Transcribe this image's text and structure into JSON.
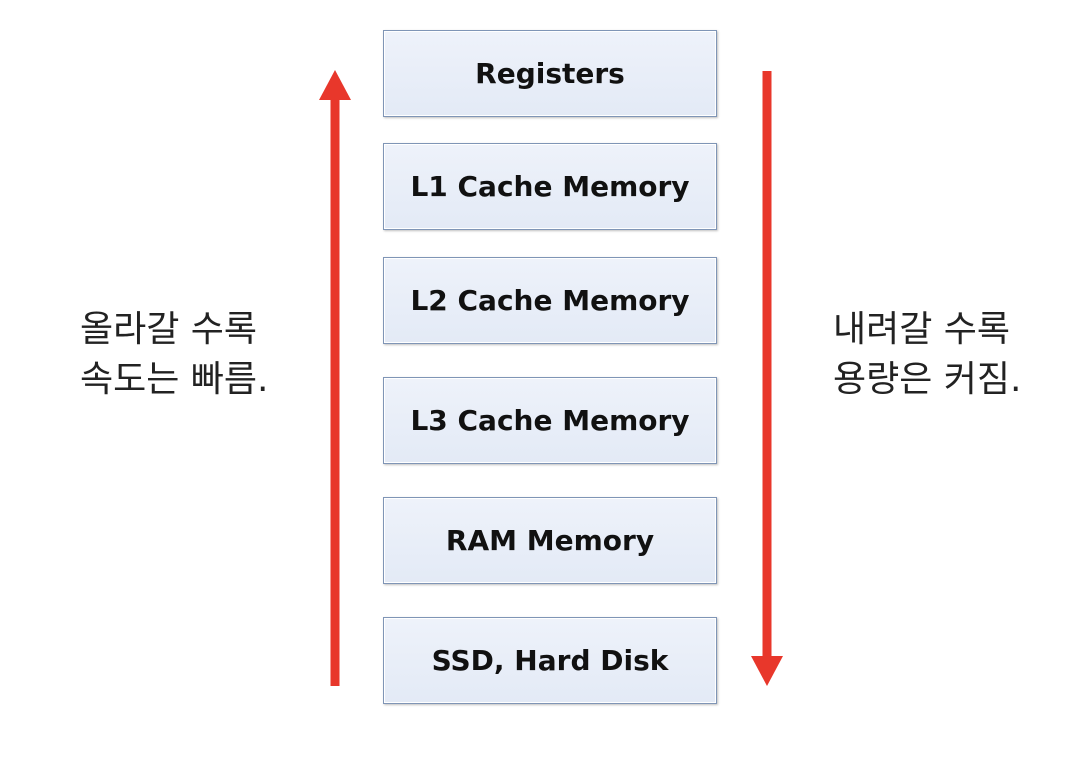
{
  "hierarchy": {
    "levels": [
      {
        "label": "Registers"
      },
      {
        "label": "L1 Cache Memory"
      },
      {
        "label": "L2 Cache Memory"
      },
      {
        "label": "L3 Cache Memory"
      },
      {
        "label": "RAM Memory"
      },
      {
        "label": "SSD, Hard Disk"
      }
    ]
  },
  "left_note": {
    "line1": "올라갈 수록",
    "line2": "속도는 빠름."
  },
  "right_note": {
    "line1": "내려갈 수록",
    "line2": "용량은 커짐."
  },
  "colors": {
    "arrow": "#e8372b",
    "box_border": "#7f95b6",
    "box_fill": "#e7edf8"
  }
}
